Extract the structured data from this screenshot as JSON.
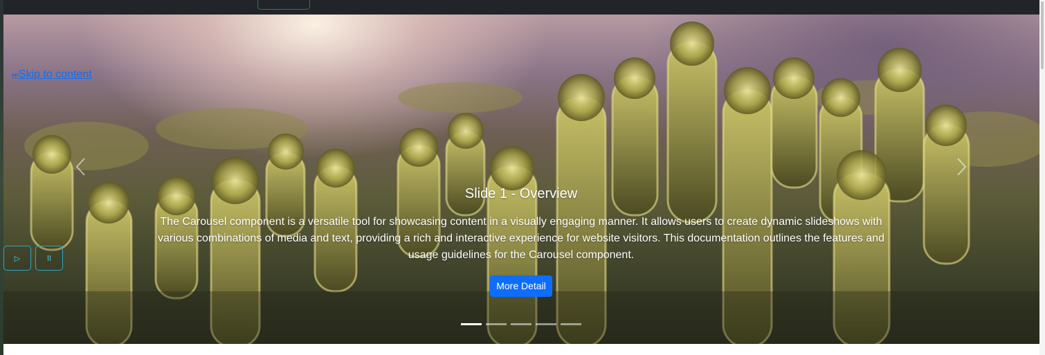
{
  "skip_link": {
    "icon": "skip-forward-icon",
    "glyph": "⏭",
    "label": "Skip to content"
  },
  "carousel": {
    "prev_glyph": "‹",
    "next_glyph": "›",
    "controls": {
      "play_glyph": "▷",
      "pause_glyph": "⏸"
    },
    "slide": {
      "title": "Slide 1 - Overview",
      "text": "The Carousel component is a versatile tool for showcasing content in a visually engaging manner. It allows users to create dynamic slideshows with various combinations of media and text, providing a rich and interactive experience for website visitors. This documentation outlines the features and usage guidelines for the Carousel component.",
      "button_label": "More Detail"
    },
    "slide_count": 5,
    "active_index": 0
  },
  "colors": {
    "topbar": "#212529",
    "primary": "#0d6efd",
    "control_border": "#2aa9c9",
    "topbar_button_border": "#198754"
  }
}
